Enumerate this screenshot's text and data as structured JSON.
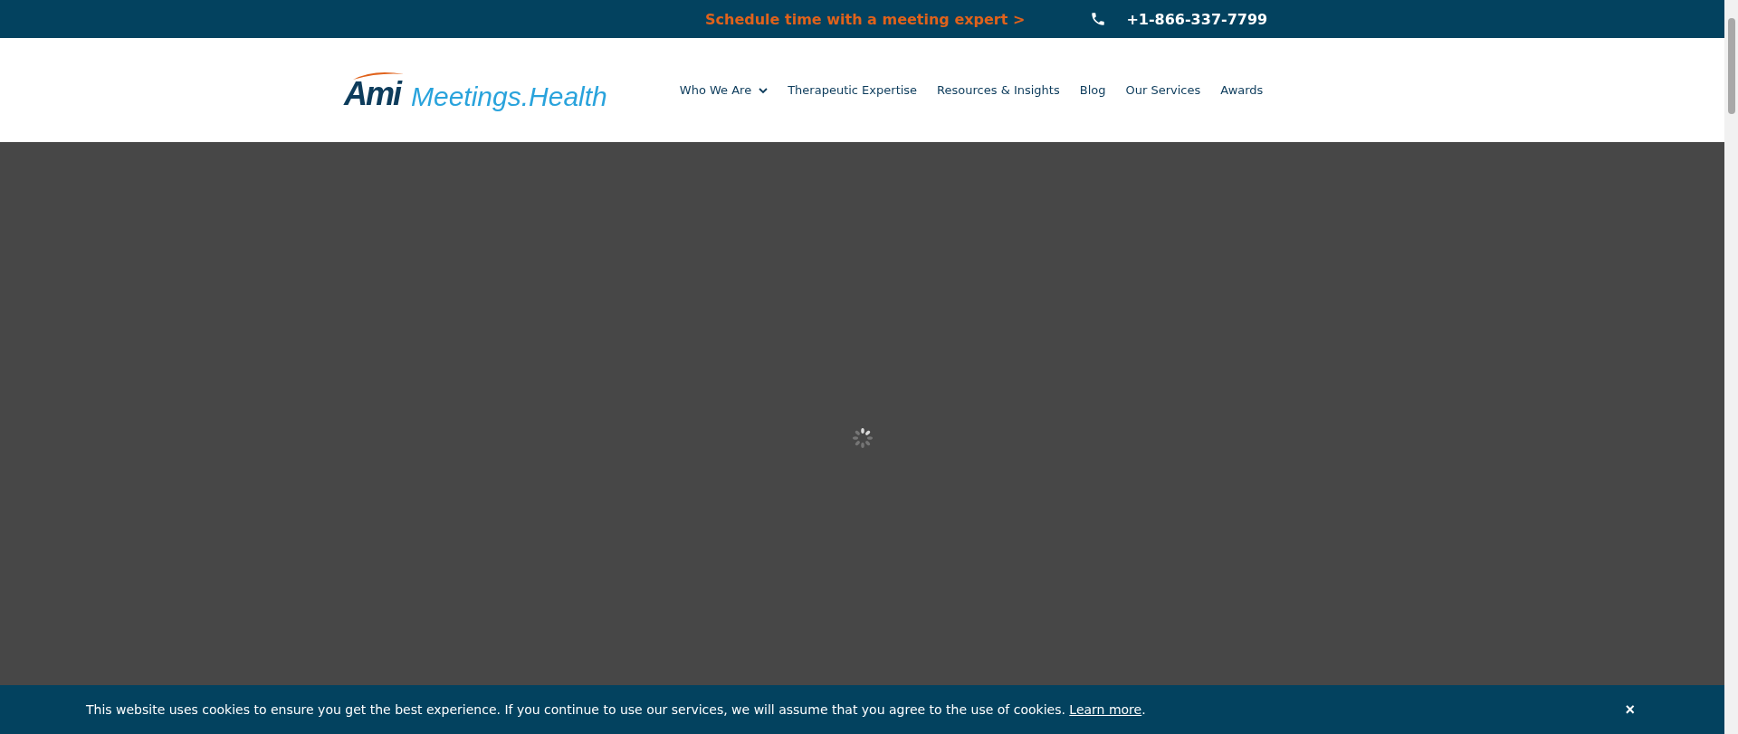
{
  "top_bar": {
    "cta": "Schedule time with a meeting expert >",
    "phone": "+1-866-337-7799"
  },
  "logo": {
    "mark": "Ami",
    "name": "Meetings.Health"
  },
  "nav": [
    {
      "label": "Who We Are",
      "has_dropdown": true
    },
    {
      "label": "Therapeutic Expertise",
      "has_dropdown": false
    },
    {
      "label": "Resources & Insights",
      "has_dropdown": false
    },
    {
      "label": "Blog",
      "has_dropdown": false
    },
    {
      "label": "Our Services",
      "has_dropdown": false
    },
    {
      "label": "Awards",
      "has_dropdown": false
    }
  ],
  "cookie_bar": {
    "message": "This website uses cookies to ensure you get the best experience. If you continue to use our services, we will assume that you agree to the use of cookies.",
    "link": "Learn more",
    "end": ".",
    "close": "×"
  }
}
